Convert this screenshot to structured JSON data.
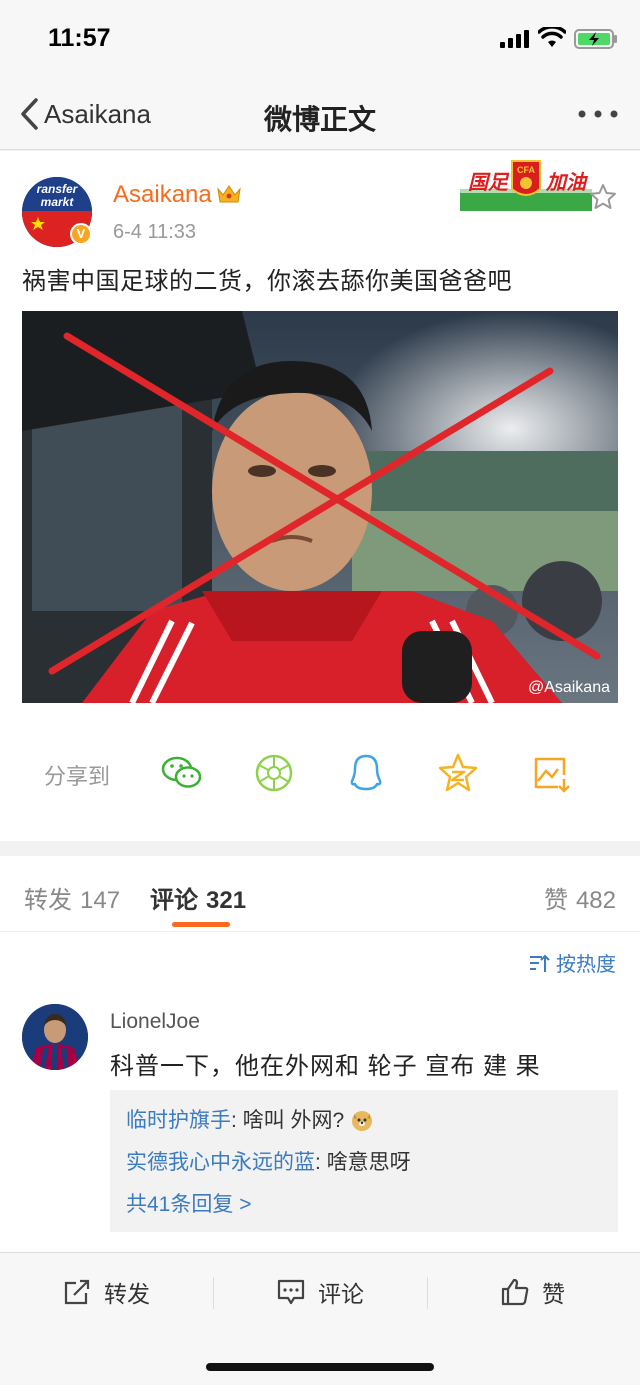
{
  "status_bar": {
    "time": "11:57"
  },
  "nav": {
    "back_label": "Asaikana",
    "title": "微博正文"
  },
  "post": {
    "author": "Asaikana",
    "time": "6-4 11:33",
    "avatar_text_1": "ransfer",
    "avatar_text_2": "markt",
    "fan_badge_text_1": "国足",
    "fan_badge_text_2": "加油",
    "fan_badge_text_3": "CFA",
    "text": "祸害中国足球的二货，你滚去舔你美国爸爸吧",
    "image_watermark": "@Asaikana"
  },
  "share": {
    "label": "分享到"
  },
  "tabs": [
    {
      "label": "转发",
      "count": "147"
    },
    {
      "label": "评论",
      "count": "321"
    },
    {
      "label": "赞",
      "count": "482"
    }
  ],
  "sort": {
    "label": "按热度"
  },
  "comment": {
    "user": "LionelJoe",
    "text": "科普一下，他在外网和 轮子 宣布  建 果",
    "replies": [
      {
        "user": "临时护旗手",
        "text": ": 啥叫 外网? "
      },
      {
        "user": "实德我心中永远的蓝",
        "text": ": 啥意思呀"
      }
    ],
    "more_replies": "共41条回复 >"
  },
  "bottom": {
    "repost": "转发",
    "comment": "评论",
    "like": "赞"
  },
  "colors": {
    "accent": "#f76b1c",
    "link": "#3b7bc0"
  }
}
